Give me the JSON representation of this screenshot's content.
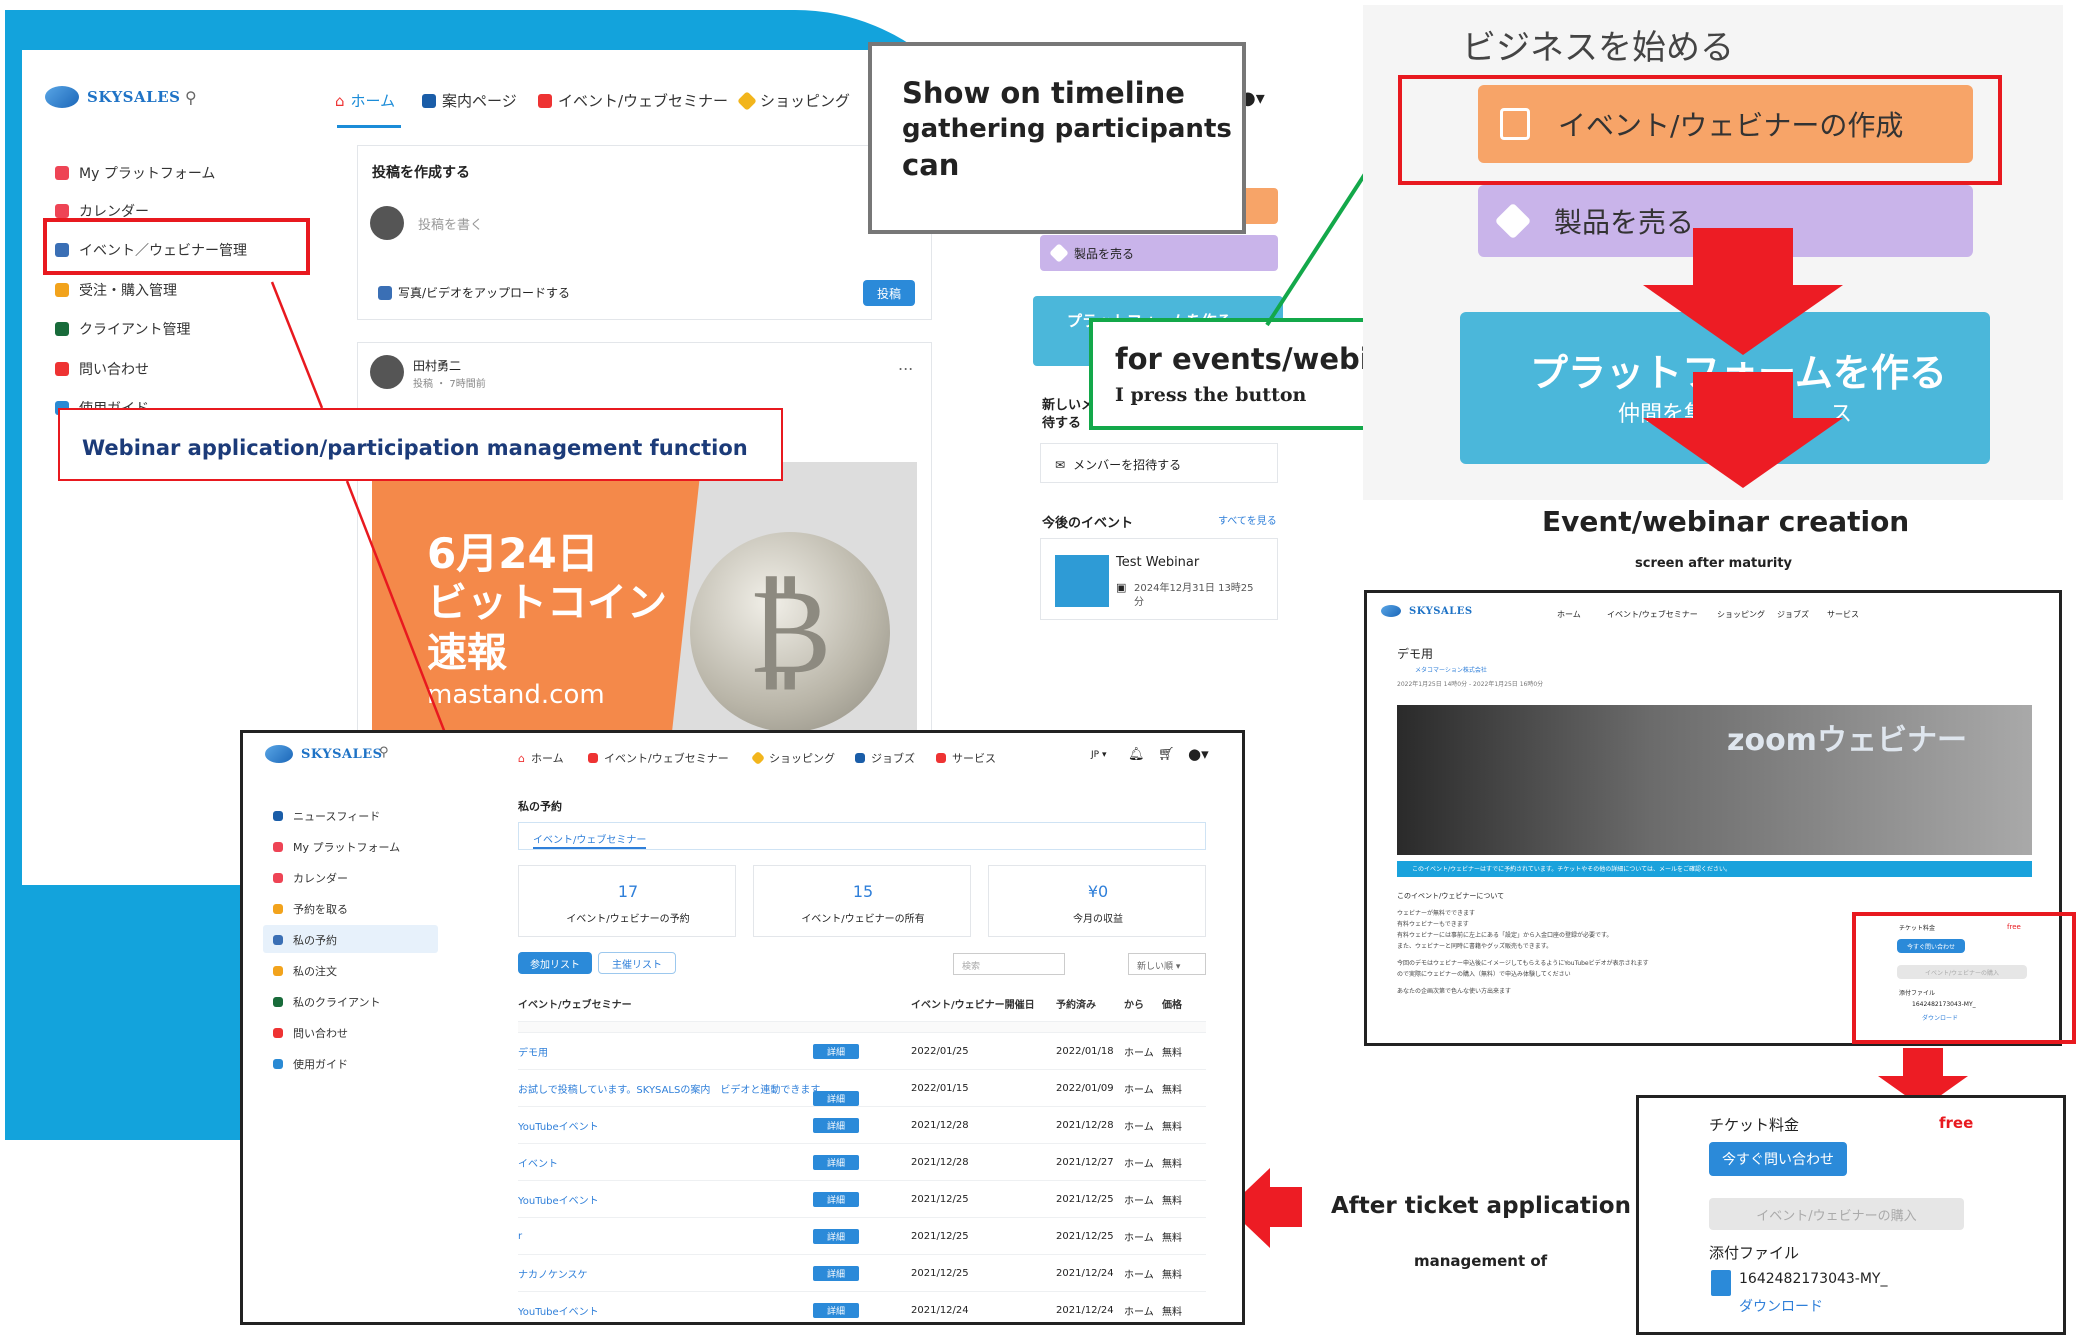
{
  "colors": {
    "brand_blue": "#13a3dc",
    "highlight_red": "#e8191f",
    "highlight_green": "#13a84a",
    "orange": "#f79a55",
    "lavender": "#c9b4ea",
    "banner_orange": "#f4894a",
    "link": "#2f7fd9",
    "free_red": "#e8191f"
  },
  "main": {
    "logo": "SKYSALES",
    "nav": [
      {
        "label": "ホーム",
        "icon": "home-icon"
      },
      {
        "label": "案内ページ",
        "icon": "page-icon"
      },
      {
        "label": "イベント/ウェブセミナー",
        "icon": "calendar-icon"
      },
      {
        "label": "ショッピング",
        "icon": "tag-icon"
      }
    ],
    "sidebar": [
      "My プラットフォーム",
      "カレンダー",
      "イベント／ウェビナー管理",
      "受注・購入管理",
      "クライアント管理",
      "問い合わせ",
      "使用ガイド"
    ],
    "post": {
      "heading": "投稿を作成する",
      "placeholder": "投稿を書く",
      "upload": "写真/ビデオをアップロードする",
      "submit": "投稿"
    },
    "feed": {
      "author": "田村勇二",
      "meta": "投稿 ・ 7時間前",
      "more": "...",
      "banner_line1": "6月24日",
      "banner_line2": "ビットコイン",
      "banner_line3": "速報",
      "banner_site": "mastand.com"
    },
    "right": {
      "sell": "製品を売る",
      "platform_btn": "プラットフォームを作る",
      "invite_heading_1": "新しいメ",
      "invite_heading_2": "待する",
      "invite": "メンバーを招待する",
      "events_heading": "今後のイベント",
      "see_all": "すべてを見る",
      "event_name": "Test Webinar",
      "event_date_1": "2024年12月31日 13時25",
      "event_date_2": "分"
    }
  },
  "callouts": {
    "timeline": {
      "l1": "Show on timeline",
      "l2": "gathering participants",
      "l3": "can"
    },
    "webinar_mgmt": "Webinar application/participation management function",
    "for_events": {
      "l1": "for events/webinars",
      "l2": "I press the button"
    },
    "creation_title": "Event/webinar creation",
    "creation_sub": "screen after maturity",
    "after_ticket": "After ticket application",
    "management_of": "management of"
  },
  "business": {
    "title": "ビジネスを始める",
    "create": "イベント/ウェビナーの作成",
    "sell": "製品を売る",
    "platform": "プラットフォームを作る",
    "platform_sub_1": "仲間を集",
    "platform_sub_2": "ス"
  },
  "reservations": {
    "logo": "SKYSALES",
    "nav": [
      {
        "label": "ホーム",
        "icon": "home-icon"
      },
      {
        "label": "イベント/ウェブセミナー",
        "icon": "calendar-icon"
      },
      {
        "label": "ショッピング",
        "icon": "tag-icon"
      },
      {
        "label": "ジョブズ",
        "icon": "bag-icon"
      },
      {
        "label": "サービス",
        "icon": "gift-icon"
      }
    ],
    "lang": "JP ▾",
    "sidebar": [
      "ニュースフィード",
      "My プラットフォーム",
      "カレンダー",
      "予約を取る",
      "私の予約",
      "私の注文",
      "私のクライアント",
      "問い合わせ",
      "使用ガイド"
    ],
    "title": "私の予約",
    "tab": "イベント/ウェブセミナー",
    "stats": [
      {
        "value": "17",
        "label": "イベント/ウェビナーの予約"
      },
      {
        "value": "15",
        "label": "イベント/ウェビナーの所有"
      },
      {
        "value": "¥0",
        "label": "今月の収益"
      }
    ],
    "btn_join": "参加リスト",
    "btn_host": "主催リスト",
    "search_placeholder": "検索",
    "sort": "新しい順 ▾",
    "headers": [
      "イベント/ウェブセミナー",
      "イベント/ウェビナー開催日",
      "予約済み",
      "から",
      "価格"
    ],
    "detail": "詳細",
    "rows": [
      [
        "デモ用",
        "2022/01/25",
        "2022/01/18",
        "ホーム",
        "無料"
      ],
      [
        "お試しで投稿しています。SKYSALSの案内　ビデオと連動できます",
        "2022/01/15",
        "2022/01/09",
        "ホーム",
        "無料"
      ],
      [
        "YouTubeイベント",
        "2021/12/28",
        "2021/12/28",
        "ホーム",
        "無料"
      ],
      [
        "イベント",
        "2021/12/28",
        "2021/12/27",
        "ホーム",
        "無料"
      ],
      [
        "YouTubeイベント",
        "2021/12/25",
        "2021/12/25",
        "ホーム",
        "無料"
      ],
      [
        "r",
        "2021/12/25",
        "2021/12/25",
        "ホーム",
        "無料"
      ],
      [
        "ナカノケンスケ",
        "2021/12/25",
        "2021/12/24",
        "ホーム",
        "無料"
      ],
      [
        "YouTubeイベント",
        "2021/12/24",
        "2021/12/24",
        "ホーム",
        "無料"
      ]
    ]
  },
  "event_detail": {
    "logo": "SKYSALES",
    "nav": [
      "ホーム",
      "イベント/ウェブセミナー",
      "ショッピング",
      "ジョブズ",
      "サービス"
    ],
    "title": "デモ用",
    "org": "メタコマーション株式会社",
    "dates": "2022年1月25日 14時0分 - 2022年1月25日 16時0分",
    "hero_text": "zoomウェビナー",
    "notice": "このイベント/ウェビナーはすでに予約されています。チケットやその他の詳細については、メールをご確認ください。",
    "about_heading": "このイベント/ウェビナーについて",
    "about_lines": [
      "ウェビナーが無料でできます",
      "有料ウェビナーもできます",
      "有料ウェビナーには事前に左上にある「設定」から入金口座の登録が必要です。",
      "また、ウェビナーと同時に書籍やグッズ販売もできます。",
      "",
      "今回のデモはウェビナー申込後にイメージしてもらえるようにYouTubeビデオが表示されます",
      "ので実際にウェビナーの購入（無料）で申込み体験してください",
      "",
      "あなたの企画次第で色んな使い方出来ます"
    ],
    "ticket_label": "チケット料金",
    "free": "free",
    "inquire": "今すぐ問い合わせ",
    "buy": "イベント/ウェビナーの購入",
    "attach": "添付ファイル",
    "file": "1642482173043-MY_",
    "download": "ダウンロード"
  },
  "ticket_zoom": {
    "ticket_label": "チケット料金",
    "free": "free",
    "inquire": "今すぐ問い合わせ",
    "buy": "イベント/ウェビナーの購入",
    "attach": "添付ファイル",
    "file": "1642482173043-MY_",
    "download": "ダウンロード"
  }
}
